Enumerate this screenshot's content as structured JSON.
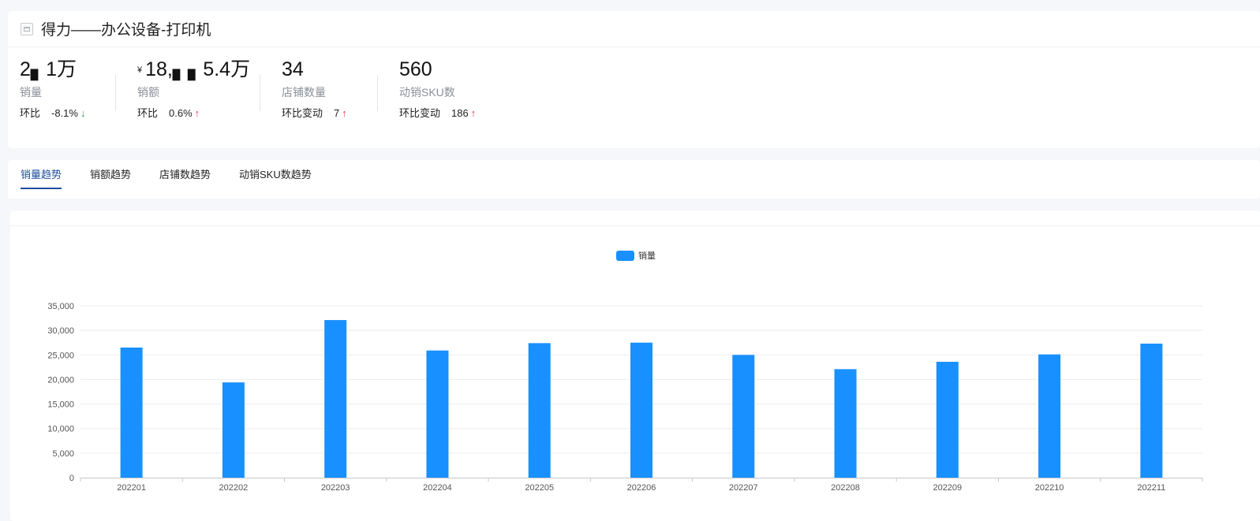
{
  "header": {
    "title": "得力——办公设备-打印机",
    "metrics": [
      {
        "value": "2▖1万",
        "label": "销量",
        "change_label": "环比",
        "change_value": "-8.1%",
        "direction": "down"
      },
      {
        "currency": "¥",
        "value": "18,▖▖5.4万",
        "label": "销额",
        "change_label": "环比",
        "change_value": "0.6%",
        "direction": "up"
      },
      {
        "value": "34",
        "label": "店铺数量",
        "change_label": "环比变动",
        "change_value": "7",
        "direction": "up"
      },
      {
        "value": "560",
        "label": "动销SKU数",
        "change_label": "环比变动",
        "change_value": "186",
        "direction": "up"
      }
    ]
  },
  "tabs": [
    {
      "label": "销量趋势",
      "active": true
    },
    {
      "label": "销额趋势",
      "active": false
    },
    {
      "label": "店铺数趋势",
      "active": false
    },
    {
      "label": "动销SKU数趋势",
      "active": false
    }
  ],
  "colors": {
    "bar": "#1890ff",
    "accent": "#1d4e9b",
    "up": "#e0424e",
    "down": "#2ca05a"
  },
  "chart_data": {
    "type": "bar",
    "legend": [
      "销量"
    ],
    "legend_position": "top-center",
    "categories": [
      "202201",
      "202202",
      "202203",
      "202204",
      "202205",
      "202206",
      "202207",
      "202208",
      "202209",
      "202210",
      "202211"
    ],
    "series": [
      {
        "name": "销量",
        "values": [
          26500,
          19400,
          32100,
          25900,
          27400,
          27500,
          25000,
          22100,
          23600,
          25100,
          27300
        ]
      }
    ],
    "ylim": [
      0,
      35000
    ],
    "yticks": [
      "0",
      "5,000",
      "10,000",
      "15,000",
      "20,000",
      "25,000",
      "30,000",
      "35,000"
    ],
    "grid": true
  }
}
